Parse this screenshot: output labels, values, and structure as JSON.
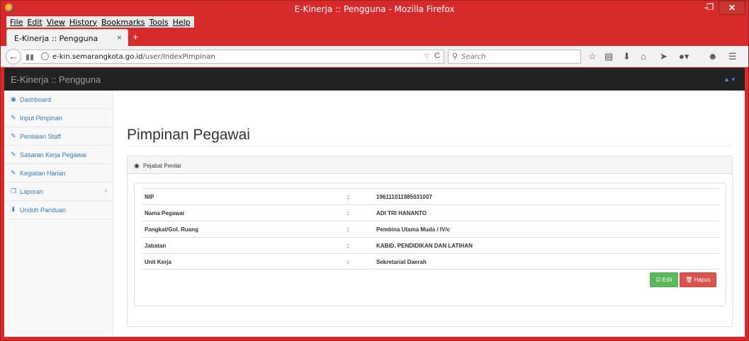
{
  "window": {
    "title": "E-Kinerja :: Pengguna - Mozilla Firefox",
    "controls": {
      "minimize": "–",
      "maximize": "❐",
      "close": "✕"
    }
  },
  "menubar": {
    "items": [
      "File",
      "Edit",
      "View",
      "History",
      "Bookmarks",
      "Tools",
      "Help"
    ]
  },
  "tabs": [
    {
      "label": "E-Kinerja :: Pengguna",
      "close": "×"
    }
  ],
  "newtab": "+",
  "nav": {
    "url_host": "e-kin.semarangkota.go.id",
    "url_path": "/user/IndexPimpinan",
    "search_placeholder": "Search"
  },
  "app": {
    "brand": "E-Kinerja :: Pengguna",
    "user_menu_icon": "user-icon"
  },
  "sidebar": {
    "items": [
      {
        "label": "Dashboard",
        "icon": "dashboard-icon"
      },
      {
        "label": "Input Pimpinan",
        "icon": "edit-icon"
      },
      {
        "label": "Penilaian Staff",
        "icon": "edit-icon"
      },
      {
        "label": "Sasaran Kerja Pegawai",
        "icon": "edit-icon"
      },
      {
        "label": "Kegiatan Harian",
        "icon": "edit-icon"
      },
      {
        "label": "Laporan",
        "icon": "copy-icon",
        "caret": "‹"
      },
      {
        "label": "Unduh Panduan",
        "icon": "download-icon"
      }
    ]
  },
  "main": {
    "title": "Pimpinan Pegawai",
    "panel_heading": "Pejabat Penilai",
    "rows": [
      {
        "key": "NIP",
        "sep": ":",
        "value": "196111011985031007"
      },
      {
        "key": "Nama Pegawai",
        "sep": ":",
        "value": "ADI TRI HANANTO"
      },
      {
        "key": "Pangkat/Gol. Ruang",
        "sep": ":",
        "value": "Pembina Utama Muda / IV/c"
      },
      {
        "key": "Jabatan",
        "sep": ":",
        "value": "KABID. PENDIDIKAN DAN LATIHAN"
      },
      {
        "key": "Unit Kerja",
        "sep": ":",
        "value": "Sekretariat Daerah"
      }
    ],
    "buttons": {
      "edit": "Edit",
      "delete": "Hapus"
    }
  },
  "colors": {
    "window_frame": "#d72b2b",
    "appbar": "#222222",
    "link": "#337ab7",
    "edit_button": "#5cb85c",
    "delete_button": "#d9534f"
  }
}
